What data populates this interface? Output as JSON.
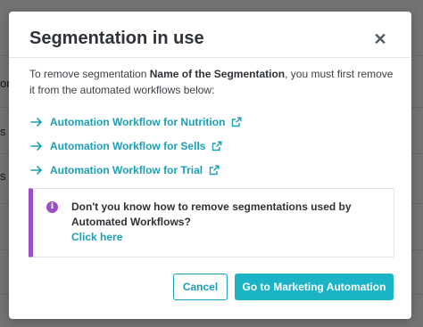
{
  "background": {
    "fragments": [
      "oro",
      "s d",
      "s"
    ]
  },
  "modal": {
    "title": "Segmentation in use",
    "close_icon": "close-icon",
    "intro_before": "To remove segmentation ",
    "intro_bold": "Name of the Segmentation",
    "intro_after": ", you must first remove it from the automated workflows below:",
    "workflows": [
      {
        "label": "Automation Workflow for Nutrition"
      },
      {
        "label": "Automation Workflow for Sells"
      },
      {
        "label": "Automation Workflow for Trial"
      }
    ],
    "callout": {
      "icon": "info-icon",
      "text": "Don't you know how to remove segmentations used by Automated Workflows?",
      "link": "Click here"
    },
    "buttons": {
      "cancel": "Cancel",
      "primary": "Go to Marketing Automation"
    }
  },
  "colors": {
    "accent": "#1a9fb6",
    "primary_button": "#1bb3c6",
    "callout_border": "#9b4fc6"
  }
}
